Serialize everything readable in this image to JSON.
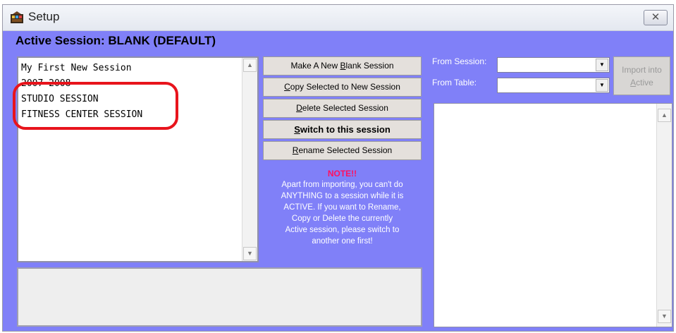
{
  "window": {
    "title": "Setup",
    "close_label": "✕"
  },
  "active_session_label": "Active Session: BLANK (DEFAULT)",
  "session_list": {
    "items": [
      "My First New Session",
      "2007-2008",
      "STUDIO SESSION",
      "FITNESS CENTER SESSION"
    ]
  },
  "buttons": {
    "make_new": {
      "pre": "Make A New ",
      "key": "B",
      "post": "lank Session"
    },
    "copy": {
      "pre": "",
      "key": "C",
      "post": "opy Selected to New Session"
    },
    "delete": {
      "pre": "",
      "key": "D",
      "post": "elete Selected Session"
    },
    "switch": {
      "pre": "",
      "key": "S",
      "post": "witch to this session"
    },
    "rename": {
      "pre": "",
      "key": "R",
      "post": "ename Selected Session"
    }
  },
  "note": {
    "title": "NOTE!!",
    "lines": [
      "Apart from importing, you can't do",
      "ANYTHING to a session while it is",
      "ACTIVE. If you want to Rename,",
      "Copy or Delete the currently",
      "Active session, please switch to",
      "another one first!"
    ]
  },
  "import": {
    "from_session_label": "From Session:",
    "from_table_label": "From Table:",
    "from_session_value": "",
    "from_table_value": "",
    "button_line1": "Import into",
    "button_line2_key": "A",
    "button_line2_rest": "ctive"
  },
  "icons": {
    "scroll_up": "▲",
    "scroll_down": "▼",
    "dropdown": "▼"
  },
  "colors": {
    "background": "#8080f8",
    "highlight_circle": "#e8141c",
    "note_title": "#ff1060"
  }
}
